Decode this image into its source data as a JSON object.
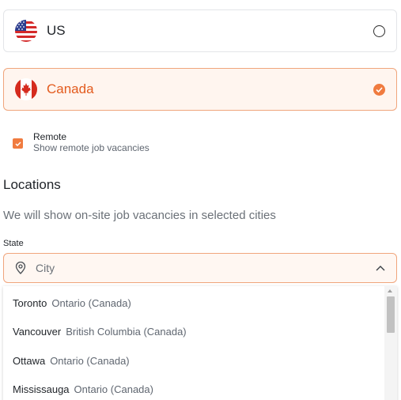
{
  "countries": [
    {
      "name": "US",
      "selected": false
    },
    {
      "name": "Canada",
      "selected": true
    }
  ],
  "remote": {
    "title": "Remote",
    "subtitle": "Show remote job vacancies",
    "checked": true
  },
  "locations": {
    "title": "Locations",
    "description": "We will show on-site job vacancies in selected cities",
    "state_label": "State",
    "city_placeholder": "City"
  },
  "cities": [
    {
      "name": "Toronto",
      "region": "Ontario (Canada)"
    },
    {
      "name": "Vancouver",
      "region": "British Columbia (Canada)"
    },
    {
      "name": "Ottawa",
      "region": "Ontario (Canada)"
    },
    {
      "name": "Mississauga",
      "region": "Ontario (Canada)"
    }
  ],
  "colors": {
    "accent": "#f07b3f",
    "accent_text": "#e35b1e",
    "selected_bg": "#fff5ef"
  },
  "icons": {
    "us_flag": "us-flag-icon",
    "ca_flag": "canada-flag-icon",
    "pin": "map-pin-icon",
    "chevron": "chevron-up-icon"
  }
}
